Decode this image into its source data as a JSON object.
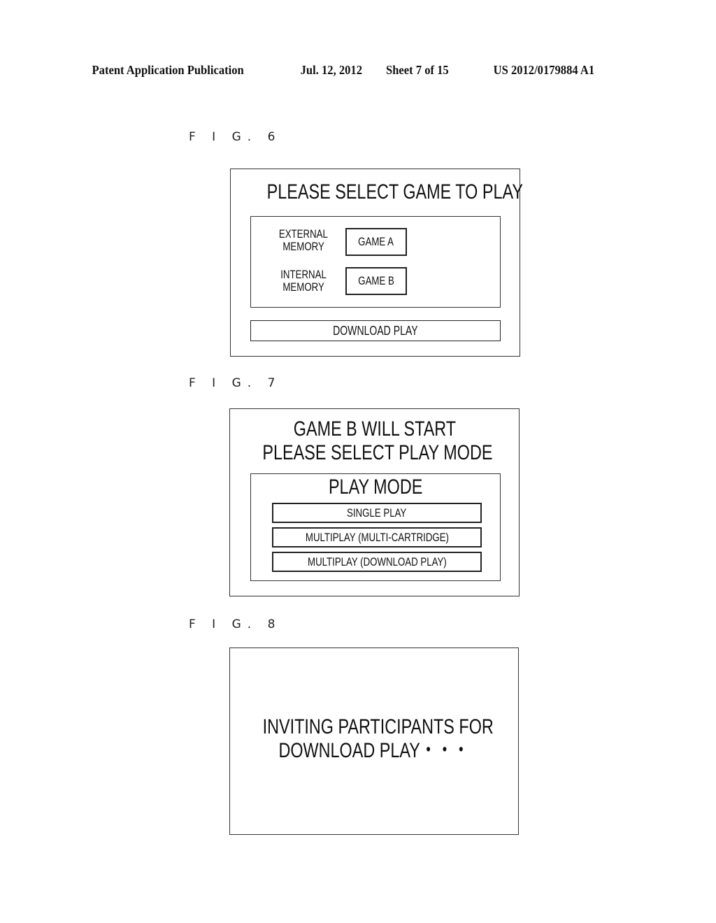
{
  "header": {
    "publication": "Patent Application Publication",
    "date": "Jul. 12, 2012",
    "sheet": "Sheet 7 of 15",
    "number": "US 2012/0179884 A1"
  },
  "fig6": {
    "label": "F I G. 6",
    "title": "PLEASE SELECT GAME TO PLAY",
    "rows": [
      {
        "source_line1": "EXTERNAL",
        "source_line2": "MEMORY",
        "button": "GAME A"
      },
      {
        "source_line1": "INTERNAL",
        "source_line2": "MEMORY",
        "button": "GAME B"
      }
    ],
    "download_button": "DOWNLOAD PLAY"
  },
  "fig7": {
    "label": "F I G. 7",
    "title_line1": "GAME B WILL START",
    "title_line2": "PLEASE SELECT PLAY MODE",
    "panel_title": "PLAY MODE",
    "options": [
      "SINGLE PLAY",
      "MULTIPLAY (MULTI-CARTRIDGE)",
      "MULTIPLAY (DOWNLOAD PLAY)"
    ]
  },
  "fig8": {
    "label": "F I G. 8",
    "message_line1": "INVITING PARTICIPANTS FOR",
    "message_line2": "DOWNLOAD PLAY・・・"
  }
}
